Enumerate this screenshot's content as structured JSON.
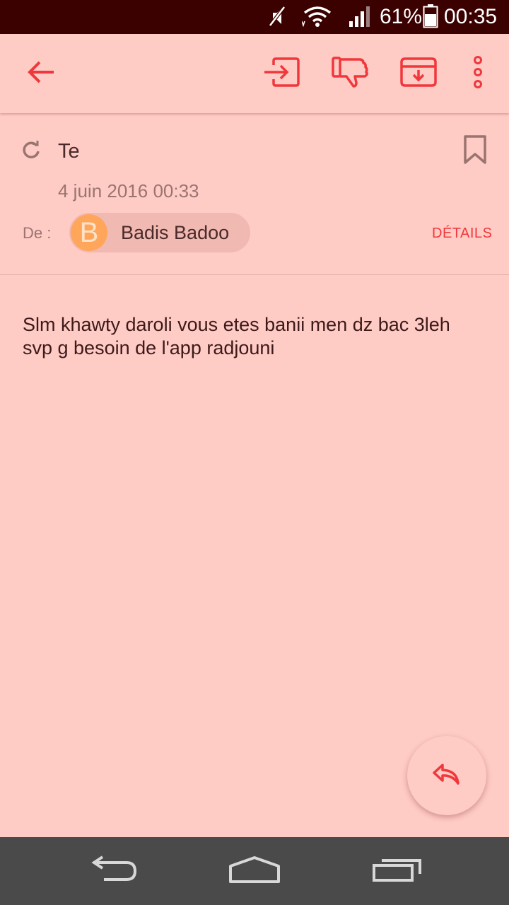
{
  "status_bar": {
    "battery": "61%",
    "clock": "00:35",
    "icons": [
      "mute-icon",
      "wifi-icon",
      "signal-icon",
      "battery-icon"
    ]
  },
  "toolbar": {
    "icons": [
      "back-arrow-icon",
      "move-to-icon",
      "thumbs-down-icon",
      "archive-icon",
      "more-vert-icon"
    ]
  },
  "message": {
    "subject": "Te",
    "date": "4 juin 2016 00:33",
    "from_label": "De :",
    "sender": {
      "initial": "B",
      "name": "Badis Badoo",
      "avatar_color": "#ffa65a"
    },
    "details_label": "DÉTAILS",
    "body": "Slm khawty daroli vous etes banii men dz bac 3leh svp g besoin de l'app radjouni"
  },
  "colors": {
    "accent": "#f0383c",
    "background": "#ffcbc5",
    "status_bar": "#3b0000",
    "nav_bar": "#4a4a4a"
  },
  "fab": {
    "icon": "reply-icon"
  },
  "nav_bar": {
    "icons": [
      "nav-back-icon",
      "nav-home-icon",
      "nav-recents-icon"
    ]
  }
}
